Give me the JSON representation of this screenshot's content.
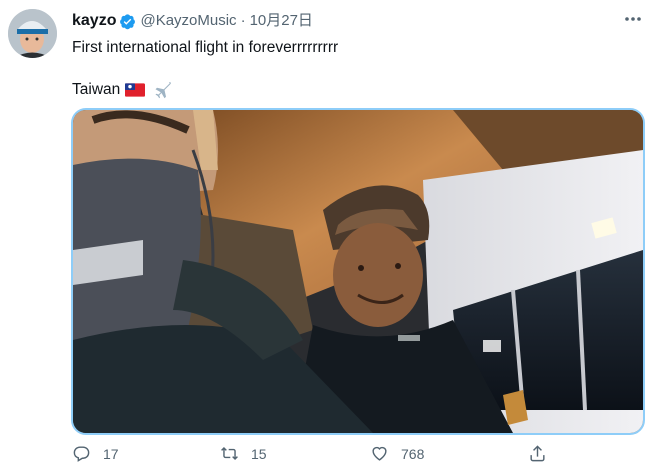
{
  "tweet": {
    "author_name": "kayzo",
    "handle": "@KayzoMusic",
    "separator": "·",
    "date": "10月27日",
    "text_line1": "First international flight in foreverrrrrrrrr",
    "text_line2": "Taiwan",
    "icons": [
      "verified-badge-icon",
      "more-options-icon",
      "taiwan-flag-emoji",
      "airplane-emoji",
      "reply-icon",
      "retweet-icon",
      "like-icon",
      "share-icon"
    ],
    "photo_caption": "",
    "counts": {
      "replies": "17",
      "retweets": "15",
      "likes": "768"
    }
  },
  "colors": {
    "text": "#0f1419",
    "secondary": "#536471",
    "verified": "#1d9bf0",
    "media_border": "#8ecdf8"
  }
}
